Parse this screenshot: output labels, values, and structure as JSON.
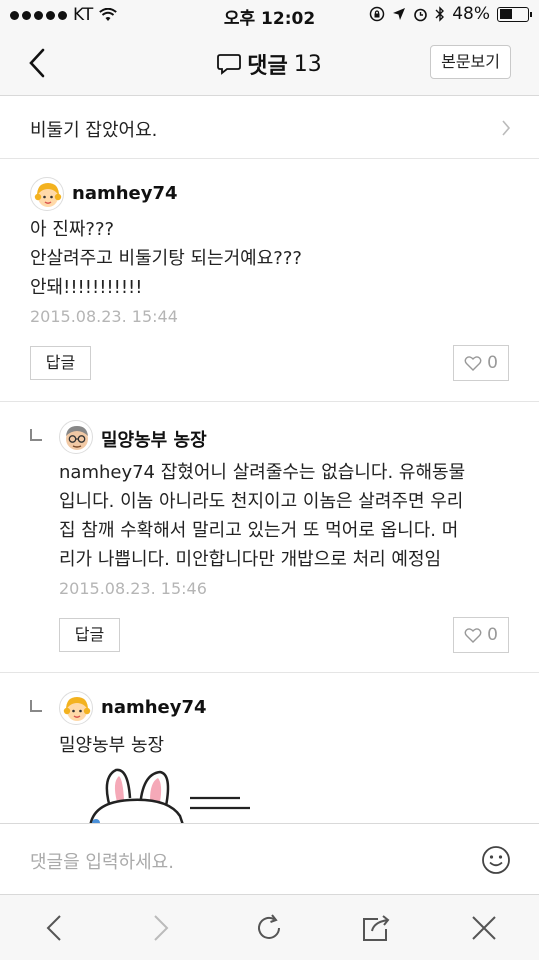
{
  "status_bar": {
    "carrier": "KT",
    "time": "오후 12:02",
    "battery_percent": "48%",
    "battery_level": 0.48
  },
  "nav": {
    "title": "댓글",
    "count": "13",
    "view_post_label": "본문보기"
  },
  "post": {
    "title": "비둘기 잡았어요."
  },
  "comments": [
    {
      "author": "namhey74",
      "text": "아 진짜???\n안살려주고 비둘기탕 되는거예요???\n안돼!!!!!!!!!!!",
      "date": "2015.08.23. 15:44",
      "reply_label": "답글",
      "likes": "0"
    },
    {
      "author": "밀양농부 농장",
      "text": "namhey74 잡혔어니 살려줄수는 없습니다. 유해동물\n입니다. 이놈 아니라도 천지이고 이놈은 살려주면 우리\n집 참깨 수확해서 말리고 있는거 또 먹어로 옵니다. 머\n리가 나쁩니다. 미안합니다만 개밥으로 처리 예정임",
      "date": "2015.08.23. 15:46",
      "reply_label": "답글",
      "likes": "0"
    },
    {
      "author": "namhey74",
      "text": "밀양농부 농장"
    }
  ],
  "input": {
    "placeholder": "댓글을 입력하세요."
  },
  "icons": {
    "back": "chevron-left-icon",
    "comment": "speech-bubble-icon",
    "heart": "heart-outline-icon",
    "emoji": "smiley-icon",
    "browser_back": "browser-back-icon",
    "browser_forward": "browser-forward-icon",
    "refresh": "refresh-icon",
    "share": "share-icon",
    "close": "close-icon"
  }
}
